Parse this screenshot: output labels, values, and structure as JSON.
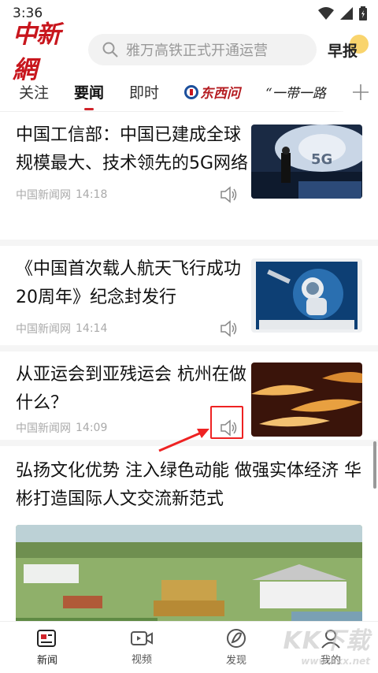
{
  "status": {
    "time": "3:36"
  },
  "header": {
    "logo": "中新網",
    "search_placeholder": "雅万高铁正式开通运营",
    "zaobao": "早报"
  },
  "tabs": [
    {
      "label": "关注"
    },
    {
      "label": "要闻",
      "active": true
    },
    {
      "label": "即时"
    },
    {
      "label": "东西问",
      "brand": true
    },
    {
      "label": "“一带一路"
    }
  ],
  "feed": [
    {
      "title": "中国工信部：中国已建成全球规模最大、技术领先的5G网络",
      "source": "中国新闻网",
      "time": "14:18",
      "thumb_icon": "5g-stage-photo"
    },
    {
      "title": "《中国首次载人航天飞行成功20周年》纪念封发行",
      "source": "中国新闻网",
      "time": "14:14",
      "thumb_icon": "astronaut-stamp-photo"
    },
    {
      "title": "从亚运会到亚残运会 杭州在做什么？",
      "source": "中国新闻网",
      "time": "14:09",
      "thumb_icon": "golden-boats-photo"
    },
    {
      "title": "弘扬文化优势 注入绿色动能 做强实体经济 华彬打造国际人文交流新范式",
      "image_icon": "campus-aerial-photo"
    }
  ],
  "bottom_nav": [
    {
      "label": "新闻",
      "icon": "news-icon",
      "active": true
    },
    {
      "label": "视频",
      "icon": "video-icon"
    },
    {
      "label": "发现",
      "icon": "discover-icon"
    },
    {
      "label": "我的",
      "icon": "profile-icon"
    }
  ],
  "watermark": {
    "brand": "KK下载",
    "url": "www.kkx.net"
  },
  "colors": {
    "brand_red": "#c8161d",
    "highlight": "#e22222"
  }
}
